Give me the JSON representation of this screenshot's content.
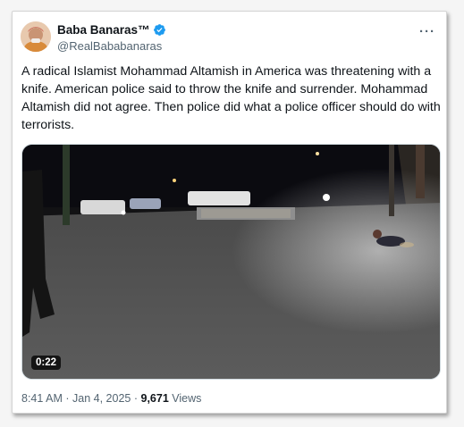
{
  "tweet": {
    "display_name": "Baba Banaras™",
    "handle": "@RealBababanaras",
    "verified": true,
    "more_icon": "···",
    "text": "A radical Islamist Mohammad Altamish in America was threatening with a knife. American police said to throw the knife and surrender. Mohammad Altamish did not agree. Then police did what a police officer should do with terrorists.",
    "media": {
      "type": "video",
      "duration": "0:22"
    },
    "time": "8:41 AM",
    "separator": "·",
    "date": "Jan 4, 2025",
    "views_count": "9,671",
    "views_label": "Views"
  },
  "colors": {
    "text_primary": "#0f1419",
    "text_secondary": "#536471",
    "verified_blue": "#1d9bf0"
  }
}
